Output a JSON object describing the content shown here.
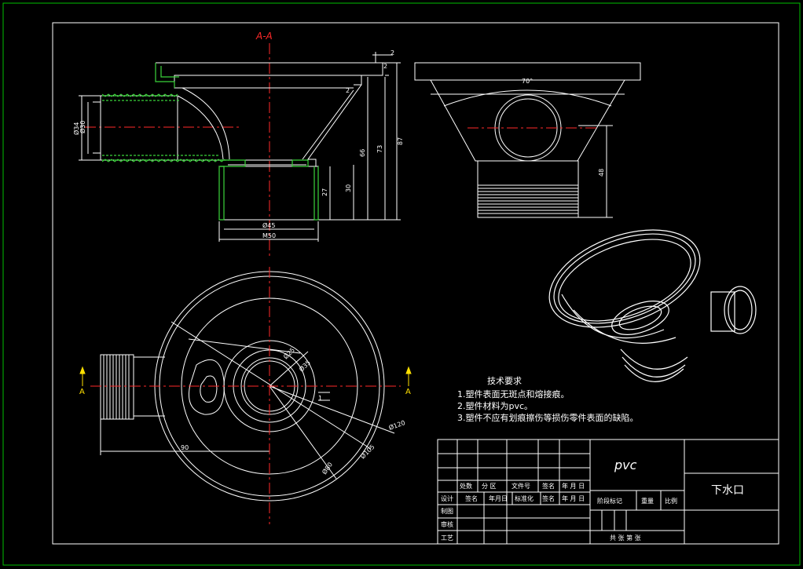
{
  "drawing": {
    "section_label": "A-A",
    "cut_marker": "A",
    "dimensions": {
      "d2a": "2",
      "d2b": "2",
      "d2c": "2",
      "d87": "87",
      "d73": "73",
      "d66": "66",
      "d30": "30",
      "d27": "27",
      "d48": "48",
      "phi45": "Ø45",
      "m50": "M50",
      "phi34": "Ø34",
      "phi30": "Ø30",
      "angle": "70°",
      "d90": "90",
      "d1": "1",
      "phi25": "Ø25",
      "phi35": "Ø35",
      "phi120": "Ø120",
      "phi105": "Ø105",
      "phi80": "Ø80"
    },
    "colors": {
      "line": "#ffffff",
      "center": "#ff2a2a",
      "hatch": "#3bd43b",
      "border": "#00c000"
    }
  },
  "notes": {
    "heading": "技术要求",
    "items": [
      "1.塑件表面无斑点和熔接痕。",
      "2.塑件材料为pvc。",
      "3.塑件不应有划痕擦伤等损伤零件表面的缺陷。"
    ]
  },
  "title_block": {
    "material": "pvc",
    "part_name": "下水口",
    "rev_headers": [
      "处数",
      "分 区",
      "文件号",
      "签名",
      "年 月 日"
    ],
    "row_design": [
      "设计",
      "签名",
      "年月日",
      "标准化",
      "签名",
      "年 月 日"
    ],
    "row_labels": [
      "制图",
      "审核",
      "工艺"
    ],
    "stage_labels": [
      "阶段标记",
      "重量",
      "比例"
    ],
    "sheet_text": "共   张 第   张"
  }
}
